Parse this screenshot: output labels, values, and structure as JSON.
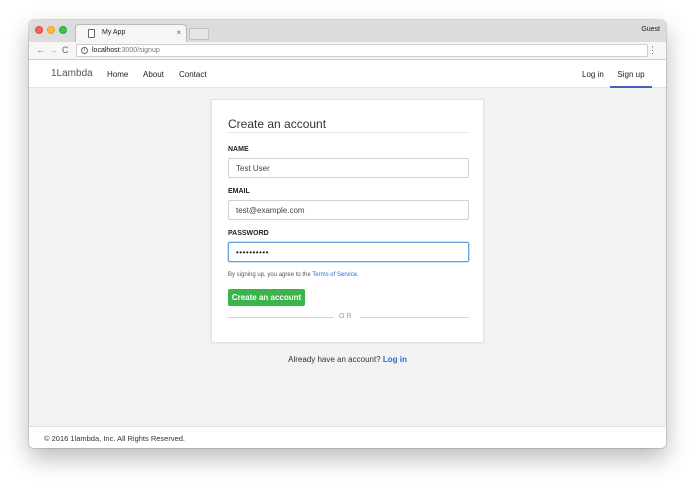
{
  "browser": {
    "tab_title": "My App",
    "tab_close": "×",
    "profile": "Guest",
    "url_host": "localhost",
    "url_path": ":3000/signup",
    "back_icon": "←",
    "forward_icon": "→",
    "reload_icon": "C",
    "menu_icon": "⋮",
    "info_icon": "i"
  },
  "navbar": {
    "brand": "1Lambda",
    "links": [
      "Home",
      "About",
      "Contact"
    ],
    "login": "Log in",
    "signup": "Sign up",
    "active_color": "#4a5fc1"
  },
  "form": {
    "title": "Create an account",
    "name_label": "NAME",
    "name_value": "Test User",
    "email_label": "EMAIL",
    "email_value": "test@example.com",
    "password_label": "PASSWORD",
    "password_value": "••••••••••",
    "terms_prefix": "By signing up, you agree to the ",
    "terms_link": "Terms of Service",
    "terms_suffix": ".",
    "submit_label": "Create an account",
    "submit_color": "#3ab54a",
    "divider_text": "OR"
  },
  "already": {
    "text": "Already have an account? ",
    "link": "Log in"
  },
  "footer": {
    "text": "© 2016 1lambda, Inc. All Rights Reserved."
  }
}
